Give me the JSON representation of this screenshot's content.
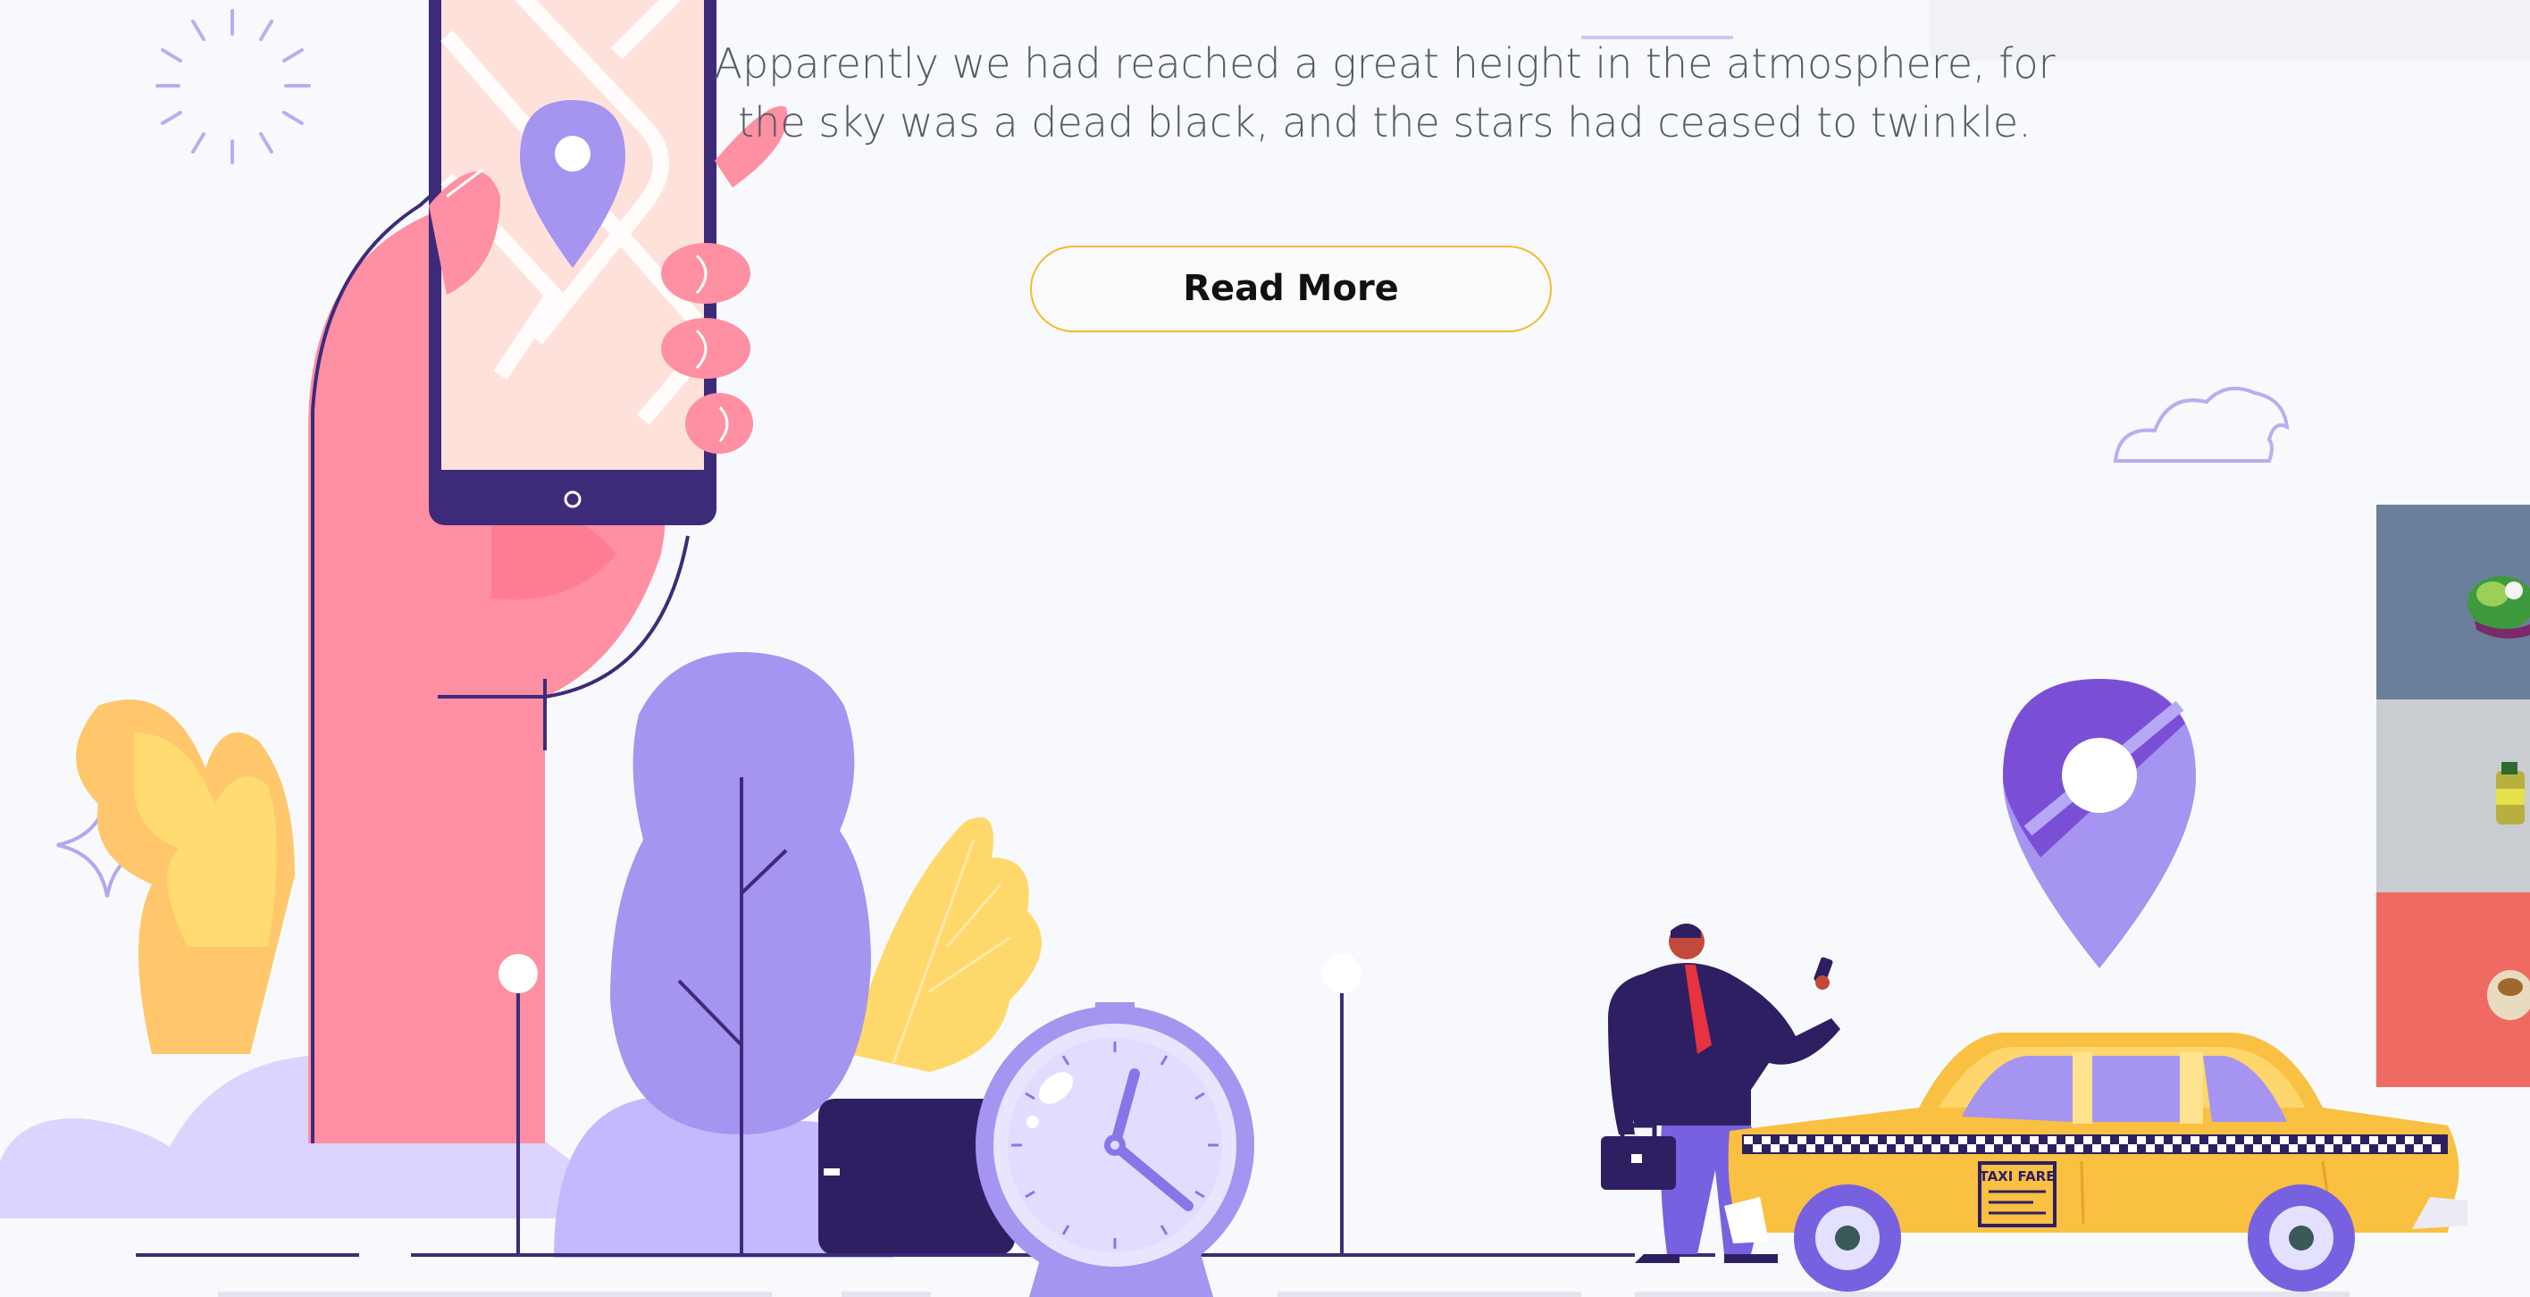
{
  "hero": {
    "description_line1": "Apparently we had reached a great height in the atmosphere, for",
    "description_line2": "the sky was a dead black, and the stars had ceased to twinkle.",
    "read_more_label": "Read More"
  },
  "illustration": {
    "taxi_sign": "TAXI FARE",
    "icons": [
      "map-pin-icon",
      "clock-icon",
      "cloud-icon",
      "sparkle-icon",
      "sun-rays-icon",
      "briefcase-icon"
    ]
  },
  "colors": {
    "button_border": "#f7b733",
    "accent_purple": "#a594f0",
    "dark_purple": "#2e1f63",
    "hand_pink": "#ff8fa3",
    "taxi_yellow": "#f9c041",
    "tile_blue": "#6a7f99",
    "tile_grey": "#c9ccd1",
    "tile_red": "#ef6a62"
  }
}
